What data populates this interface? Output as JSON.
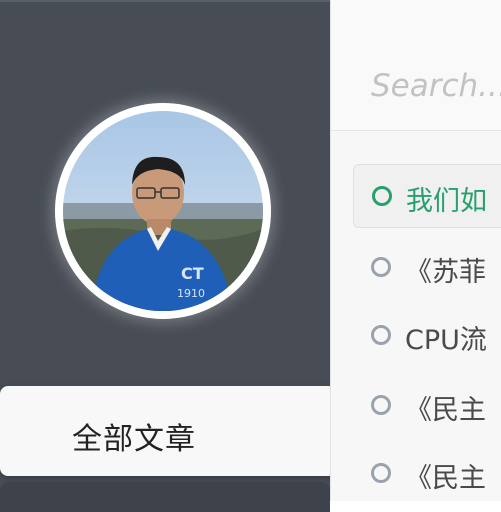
{
  "sidebar": {
    "avatar_alt": "avatar",
    "nav": [
      {
        "label": "全部文章"
      }
    ]
  },
  "search": {
    "placeholder": "Search..."
  },
  "posts": [
    {
      "title": "我们如",
      "active": true
    },
    {
      "title": "《苏菲",
      "active": false
    },
    {
      "title": "CPU流",
      "active": false
    },
    {
      "title": "《民主",
      "active": false
    },
    {
      "title": "《民主",
      "active": false
    }
  ],
  "colors": {
    "sidebar_bg": "#474c55",
    "accent": "#28a06e",
    "list_bg": "#f7f7f7"
  }
}
